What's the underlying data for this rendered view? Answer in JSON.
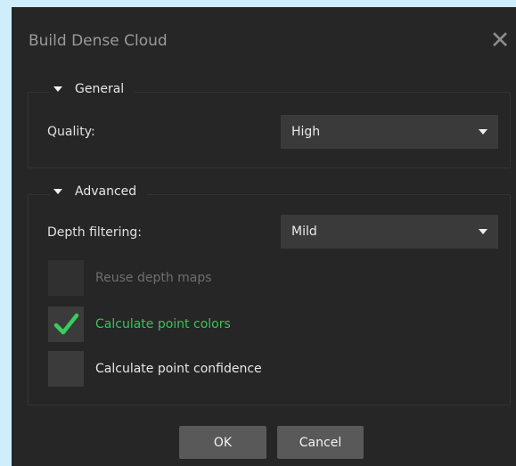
{
  "dialog": {
    "title": "Build Dense Cloud",
    "close_icon": "close-icon"
  },
  "general": {
    "header": "General",
    "quality_label": "Quality:",
    "quality_value": "High"
  },
  "advanced": {
    "header": "Advanced",
    "depth_filtering_label": "Depth filtering:",
    "depth_filtering_value": "Mild",
    "checkboxes": [
      {
        "label": "Reuse depth maps",
        "checked": false,
        "enabled": false
      },
      {
        "label": "Calculate point colors",
        "checked": true,
        "enabled": true
      },
      {
        "label": "Calculate point confidence",
        "checked": false,
        "enabled": true
      }
    ]
  },
  "buttons": {
    "ok": "OK",
    "cancel": "Cancel"
  },
  "colors": {
    "dialog_bg": "#262626",
    "checked_text": "#39c35a",
    "page_bg": "#cdeefa"
  }
}
